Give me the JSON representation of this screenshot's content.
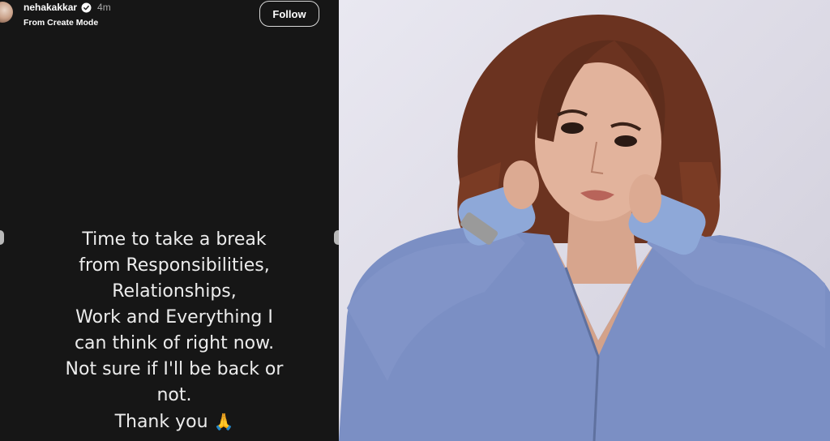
{
  "story": {
    "username": "nehakakkar",
    "time_ago": "4m",
    "subtitle": "From Create Mode",
    "follow_label": "Follow",
    "message_lines": [
      "Time to take a break",
      "from Responsibilities,",
      "Relationships,",
      "Work and Everything I",
      "can think of right now.",
      "Not sure if I'll be back or",
      "not."
    ],
    "closing": "Thank you",
    "closing_emoji": "🙏"
  },
  "icons": {
    "verified": "verified-badge-icon",
    "prayer": "folded-hands-icon"
  },
  "colors": {
    "story_bg": "#161616",
    "text": "#ececec",
    "photo_bg": "#e3e2ec",
    "denim": "#7b8fc4"
  }
}
